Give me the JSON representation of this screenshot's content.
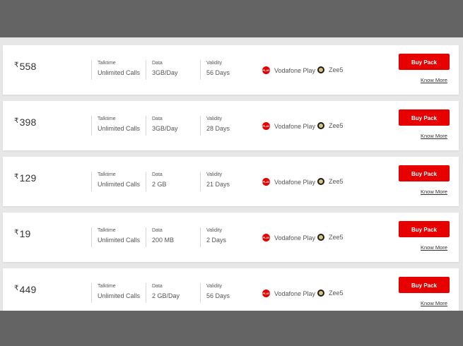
{
  "plans": [
    {
      "price": "558",
      "talktime_label": "Talktime",
      "talktime": "Unlimited Calls",
      "data_label": "Data",
      "data": "3GB/Day",
      "validity_label": "Validity",
      "validity": "56 Days",
      "ott1_badge": "PLAY",
      "ott1": "Vodafone Play",
      "ott2": "Zee5",
      "buy": "Buy Pack",
      "know": "Know More"
    },
    {
      "price": "398",
      "talktime_label": "Talktime",
      "talktime": "Unlimited Calls",
      "data_label": "Data",
      "data": "3GB/Day",
      "validity_label": "Validity",
      "validity": "28 Days",
      "ott1_badge": "PLAY",
      "ott1": "Vodafone Play",
      "ott2": "Zee5",
      "buy": "Buy Pack",
      "know": "Know More"
    },
    {
      "price": "129",
      "talktime_label": "Talktime",
      "talktime": "Unlimited Calls",
      "data_label": "Data",
      "data": "2 GB",
      "validity_label": "Validity",
      "validity": "21 Days",
      "ott1_badge": "PLAY",
      "ott1": "Vodafone Play",
      "ott2": "Zee5",
      "buy": "Buy Pack",
      "know": "Know More"
    },
    {
      "price": "19",
      "talktime_label": "Talktime",
      "talktime": "Unlimited Calls",
      "data_label": "Data",
      "data": "200 MB",
      "validity_label": "Validity",
      "validity": "2 Days",
      "ott1_badge": "PLAY",
      "ott1": "Vodafone Play",
      "ott2": "Zee5",
      "buy": "Buy Pack",
      "know": "Know More"
    },
    {
      "price": "449",
      "talktime_label": "Talktime",
      "talktime": "Unlimited Calls",
      "data_label": "Data",
      "data": "2 GB/Day",
      "validity_label": "Validity",
      "validity": "56 Days",
      "ott1_badge": "PLAY",
      "ott1": "Vodafone Play",
      "ott2": "Zee5",
      "buy": "Buy Pack",
      "know": "Know More"
    }
  ],
  "currency_symbol": "₹",
  "colors": {
    "accent": "#e60000",
    "page_bg": "#646464",
    "list_bg": "#e7e7e7"
  },
  "icons": {
    "ott1": "vodafone-play-icon",
    "ott2": "zee5-icon"
  }
}
